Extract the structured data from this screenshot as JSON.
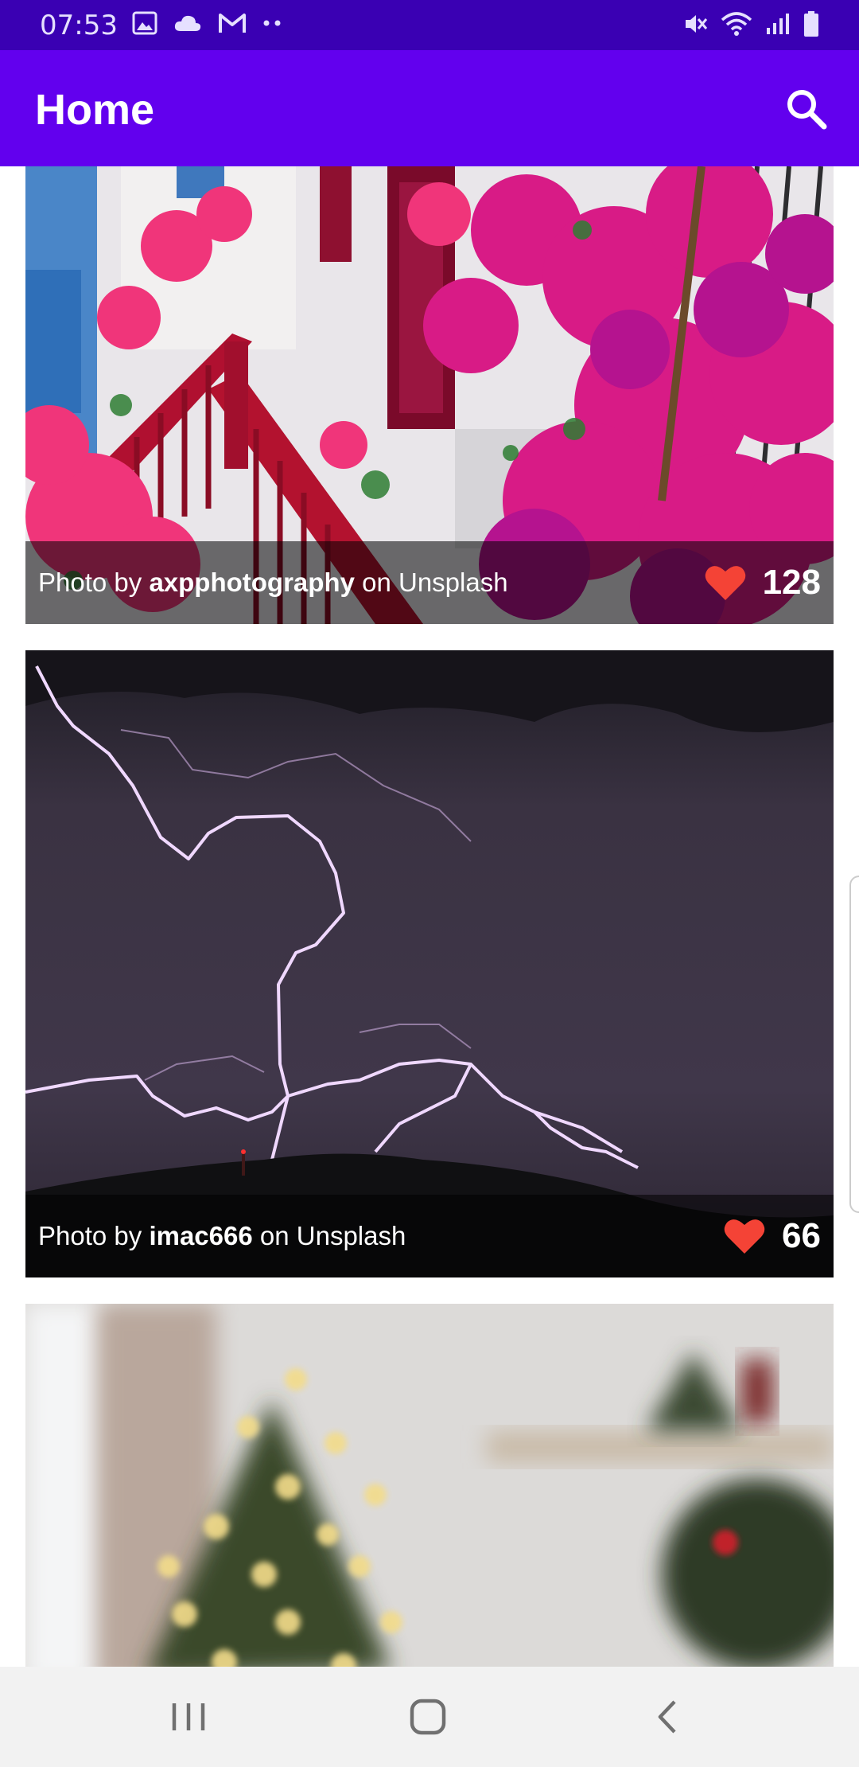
{
  "status_bar": {
    "time": "07:53",
    "left_icons": [
      "image-icon",
      "cloud-icon",
      "gmail-icon",
      "more-dots-icon"
    ],
    "right_icons": [
      "mute-icon",
      "wifi-icon",
      "signal-icon",
      "battery-icon"
    ]
  },
  "app_bar": {
    "title": "Home",
    "search_icon": "search-icon"
  },
  "photos": [
    {
      "prefix": "Photo by ",
      "author": "axpphotography",
      "suffix": " on Unsplash",
      "likes": "128"
    },
    {
      "prefix": "Photo by ",
      "author": "imac666",
      "suffix": " on Unsplash",
      "likes": "66"
    }
  ],
  "nav_bar": {
    "buttons": [
      "recent-apps-icon",
      "home-icon",
      "back-icon"
    ]
  },
  "colors": {
    "status_bar": "#3a00b3",
    "app_bar": "#6200ee",
    "heart": "#f44336",
    "nav_bar": "#f2f2f2"
  }
}
